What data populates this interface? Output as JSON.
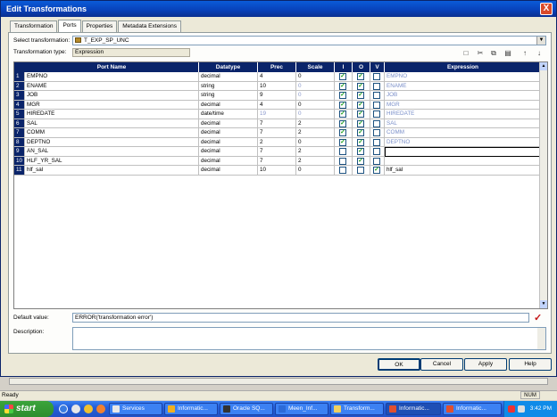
{
  "window": {
    "title": "Edit Transformations",
    "close": "X"
  },
  "tabs": [
    "Transformation",
    "Ports",
    "Properties",
    "Metadata Extensions"
  ],
  "active_tab": "Ports",
  "select_transformation": {
    "label": "Select transformation:",
    "value": "T_EXP_SP_UNC"
  },
  "transformation_type": {
    "label": "Transformation type:",
    "value": "Expression"
  },
  "columns": [
    "Port Name",
    "Datatype",
    "Prec",
    "Scale",
    "I",
    "O",
    "V",
    "Expression"
  ],
  "rows": [
    {
      "num": "1",
      "name": "EMPNO",
      "type": "decimal",
      "prec": "4",
      "scale": "0",
      "i": true,
      "o": true,
      "v": false,
      "expr": "EMPNO"
    },
    {
      "num": "2",
      "name": "ENAME",
      "type": "string",
      "prec": "10",
      "scale": "0",
      "i": true,
      "o": true,
      "v": false,
      "expr": "ENAME"
    },
    {
      "num": "3",
      "name": "JOB",
      "type": "string",
      "prec": "9",
      "scale": "0",
      "i": true,
      "o": true,
      "v": false,
      "expr": "JOB"
    },
    {
      "num": "4",
      "name": "MGR",
      "type": "decimal",
      "prec": "4",
      "scale": "0",
      "i": true,
      "o": true,
      "v": false,
      "expr": "MGR"
    },
    {
      "num": "5",
      "name": "HIREDATE",
      "type": "date/time",
      "prec": "19",
      "scale": "0",
      "i": true,
      "o": true,
      "v": false,
      "expr": "HIREDATE"
    },
    {
      "num": "6",
      "name": "SAL",
      "type": "decimal",
      "prec": "7",
      "scale": "2",
      "i": true,
      "o": true,
      "v": false,
      "expr": "SAL"
    },
    {
      "num": "7",
      "name": "COMM",
      "type": "decimal",
      "prec": "7",
      "scale": "2",
      "i": true,
      "o": true,
      "v": false,
      "expr": "COMM"
    },
    {
      "num": "8",
      "name": "DEPTNO",
      "type": "decimal",
      "prec": "2",
      "scale": "0",
      "i": true,
      "o": true,
      "v": false,
      "expr": "DEPTNO"
    },
    {
      "num": "9",
      "name": "AN_SAL",
      "type": "decimal",
      "prec": "7",
      "scale": "2",
      "i": false,
      "o": true,
      "v": false,
      "expr": ""
    },
    {
      "num": "10",
      "name": "HLF_YR_SAL",
      "type": "decimal",
      "prec": "7",
      "scale": "2",
      "i": false,
      "o": true,
      "v": false,
      "expr": ""
    },
    {
      "num": "11",
      "name": "hlf_sal",
      "type": "decimal",
      "prec": "10",
      "scale": "0",
      "i": false,
      "o": false,
      "v": true,
      "expr": "hlf_sal"
    }
  ],
  "default_value": {
    "label": "Default value:",
    "value": "ERROR('transformation error')"
  },
  "description": {
    "label": "Description:",
    "value": ""
  },
  "buttons": {
    "ok": "OK",
    "cancel": "Cancel",
    "apply": "Apply",
    "help": "Help"
  },
  "statusbar": {
    "text": "Ready",
    "num": "NUM"
  },
  "taskbar": {
    "start": "start",
    "tasks": [
      "Services",
      "Informatic...",
      "Oracle SQ...",
      "Meen_Inf...",
      "Transform...",
      "Informatic...",
      "Informatic..."
    ],
    "clock": "3:42 PM"
  }
}
